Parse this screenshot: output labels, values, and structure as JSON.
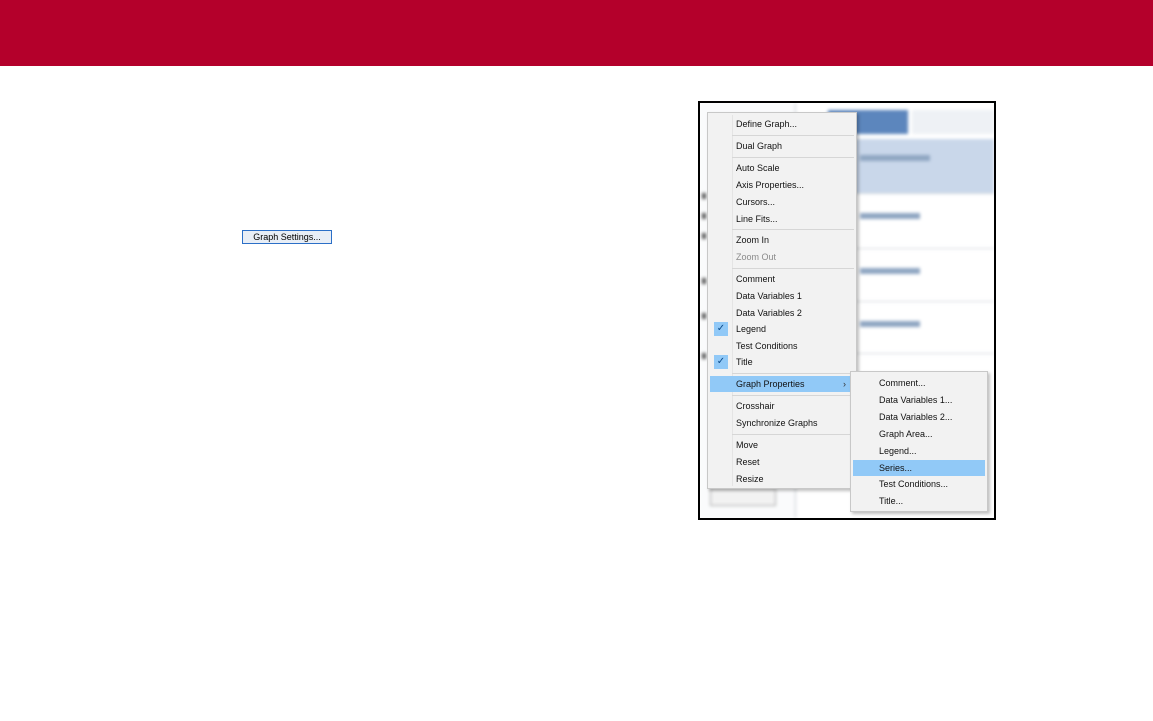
{
  "graph_settings_button": "Graph Settings...",
  "context_menu": {
    "items": [
      {
        "label": "Define Graph..."
      },
      {
        "label": "Dual Graph"
      },
      {
        "label": "Auto Scale"
      },
      {
        "label": "Axis Properties..."
      },
      {
        "label": "Cursors..."
      },
      {
        "label": "Line Fits..."
      },
      {
        "label": "Zoom In"
      },
      {
        "label": "Zoom Out",
        "disabled": true
      },
      {
        "label": "Comment"
      },
      {
        "label": "Data Variables 1"
      },
      {
        "label": "Data Variables 2"
      },
      {
        "label": "Legend",
        "checked": true
      },
      {
        "label": "Test Conditions"
      },
      {
        "label": "Title",
        "checked": true
      },
      {
        "label": "Graph Properties",
        "highlighted": true,
        "submenu": true
      },
      {
        "label": "Crosshair"
      },
      {
        "label": "Synchronize Graphs"
      },
      {
        "label": "Move"
      },
      {
        "label": "Reset"
      },
      {
        "label": "Resize"
      }
    ],
    "check_glyph": "✓",
    "submenu_arrow": "›"
  },
  "graph_properties_submenu": {
    "items": [
      {
        "label": "Comment..."
      },
      {
        "label": "Data Variables 1..."
      },
      {
        "label": "Data Variables 2..."
      },
      {
        "label": "Graph Area..."
      },
      {
        "label": "Legend..."
      },
      {
        "label": "Series...",
        "highlighted": true
      },
      {
        "label": "Test Conditions..."
      },
      {
        "label": "Title..."
      }
    ]
  },
  "colors": {
    "banner": "#b4002b",
    "menu_background": "#f2f2f2",
    "menu_highlight": "#91c9f7",
    "button_border": "#2b6fc7"
  }
}
